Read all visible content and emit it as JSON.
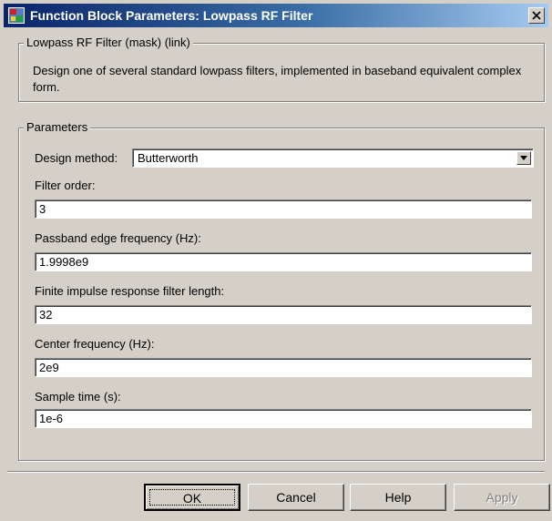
{
  "window": {
    "title": "Function Block Parameters: Lowpass RF Filter",
    "icon": "simulink-block-icon",
    "close_icon": "close-icon"
  },
  "description": {
    "group_label": "Lowpass RF Filter (mask) (link)",
    "text": "Design one of several standard lowpass filters, implemented in baseband equivalent complex form."
  },
  "parameters": {
    "group_label": "Parameters",
    "design_method": {
      "label": "Design method:",
      "value": "Butterworth"
    },
    "filter_order": {
      "label": "Filter order:",
      "value": "3"
    },
    "passband_edge": {
      "label": "Passband edge frequency (Hz):",
      "value": "1.9998e9"
    },
    "fir_length": {
      "label": "Finite impulse response filter length:",
      "value": "32"
    },
    "center_freq": {
      "label": "Center frequency (Hz):",
      "value": "2e9"
    },
    "sample_time": {
      "label": "Sample time (s):",
      "value": "1e-6"
    }
  },
  "buttons": {
    "ok": "OK",
    "cancel": "Cancel",
    "help": "Help",
    "apply": "Apply"
  }
}
